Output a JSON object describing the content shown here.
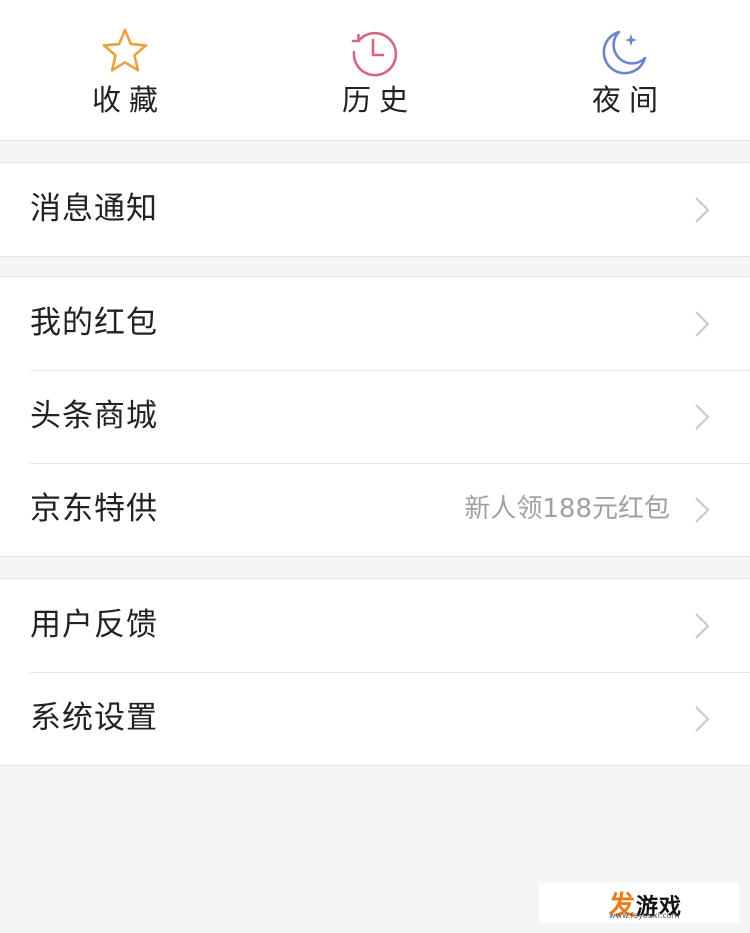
{
  "top_actions": [
    {
      "label": "收藏",
      "icon": "star-icon",
      "color": "#e8a33d"
    },
    {
      "label": "历史",
      "icon": "history-clock-icon",
      "color": "#d9667f"
    },
    {
      "label": "夜间",
      "icon": "moon-icon",
      "color": "#6b86c9"
    }
  ],
  "groups": [
    {
      "items": [
        {
          "label": "消息通知"
        }
      ]
    },
    {
      "items": [
        {
          "label": "我的红包"
        },
        {
          "label": "头条商城"
        },
        {
          "label": "京东特供",
          "extra": "新人领188元红包"
        }
      ]
    },
    {
      "items": [
        {
          "label": "用户反馈"
        },
        {
          "label": "系统设置"
        }
      ]
    }
  ],
  "watermark": {
    "first_char": "发",
    "rest": "游戏",
    "url": "www.fayouxi.com"
  }
}
